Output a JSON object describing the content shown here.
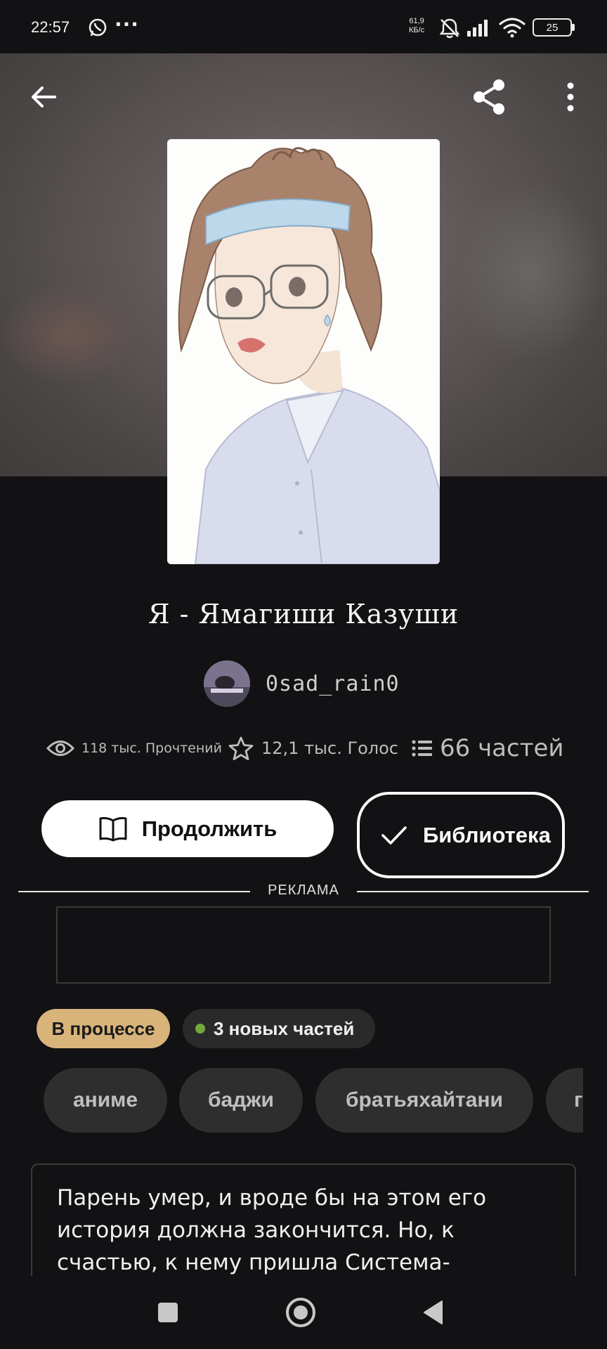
{
  "status_bar": {
    "time": "22:57",
    "more": "···",
    "speed_value": "61,9",
    "speed_unit": "КБ/с",
    "battery": "25",
    "icons": [
      "whatsapp-icon",
      "bell-off-icon",
      "signal-icon",
      "wifi-icon",
      "battery-icon"
    ]
  },
  "header": {
    "icons": [
      "arrow-left-icon",
      "share-icon",
      "more-vertical-icon"
    ]
  },
  "story": {
    "title": "Я - Ямагиши Казуши",
    "author": "0sad_rain0",
    "reads": "118 тыс. Прочтений",
    "votes": "12,1 тыс. Голос",
    "parts": "66 частей"
  },
  "actions": {
    "continue_label": "Продолжить",
    "library_label": "Библиотека"
  },
  "ad": {
    "label": "РЕКЛАМА"
  },
  "badges": {
    "status": "В процессе",
    "new_parts": "3 новых частей"
  },
  "tags": [
    "аниме",
    "баджи",
    "братьяхайтани",
    "г"
  ],
  "description": "Парень умер, и вроде бы на этом его история должна закончится. Но, к счастью, к нему пришла Система-гаремник с",
  "colors": {
    "background": "#121113",
    "status_badge": "#d8b47a",
    "new_dot": "#75a83d",
    "tag_bg": "#2f2e2e"
  }
}
